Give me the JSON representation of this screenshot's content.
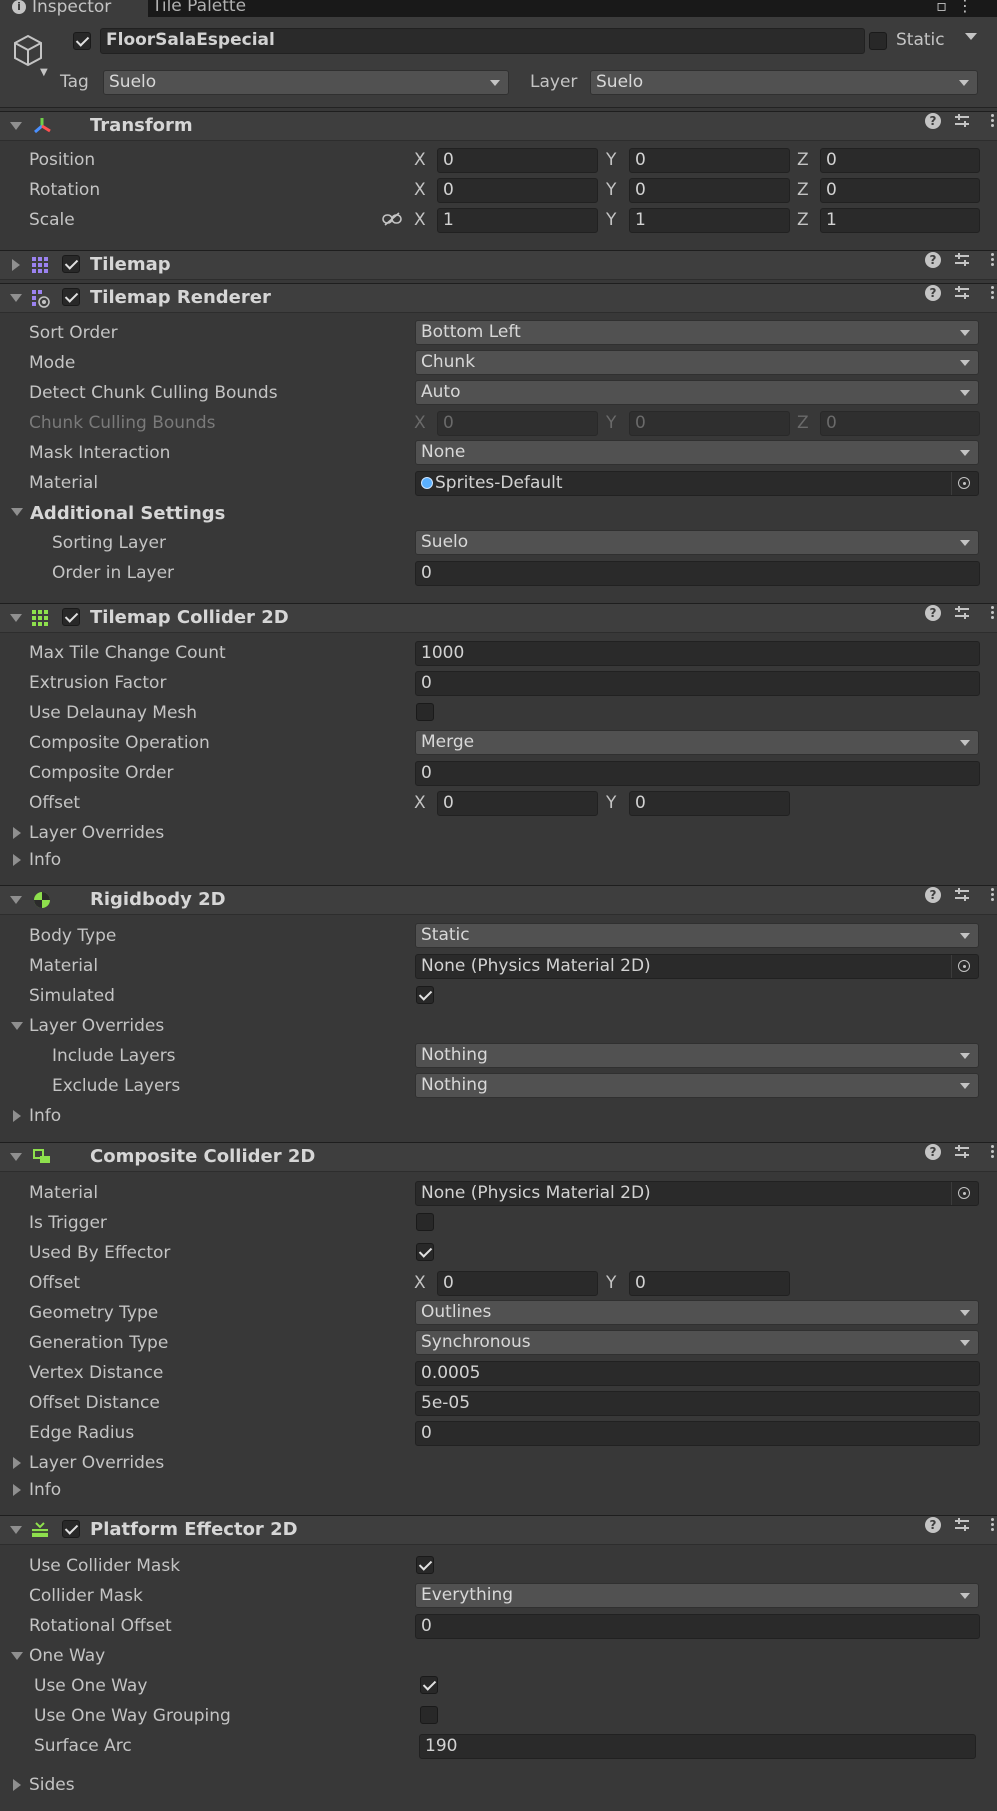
{
  "tabs": {
    "inspector": "Inspector",
    "tile_palette": "Tile Palette"
  },
  "gameobject": {
    "active": true,
    "name": "FloorSalaEspecial",
    "static_label": "Static",
    "static": false,
    "tag_label": "Tag",
    "tag": "Suelo",
    "layer_label": "Layer",
    "layer": "Suelo"
  },
  "transform": {
    "title": "Transform",
    "rows": [
      {
        "label": "Position",
        "x": "0",
        "y": "0",
        "z": "0"
      },
      {
        "label": "Rotation",
        "x": "0",
        "y": "0",
        "z": "0"
      },
      {
        "label": "Scale",
        "x": "1",
        "y": "1",
        "z": "1"
      }
    ]
  },
  "axes": {
    "x": "X",
    "y": "Y",
    "z": "Z"
  },
  "tilemap": {
    "title": "Tilemap",
    "enabled": true
  },
  "tilemap_renderer": {
    "title": "Tilemap Renderer",
    "enabled": true,
    "sort_order_label": "Sort Order",
    "sort_order": "Bottom Left",
    "mode_label": "Mode",
    "mode": "Chunk",
    "detect_label": "Detect Chunk Culling Bounds",
    "detect": "Auto",
    "chunk_label": "Chunk Culling Bounds",
    "chunk_x": "0",
    "chunk_y": "0",
    "chunk_z": "0",
    "mask_label": "Mask Interaction",
    "mask": "None",
    "material_label": "Material",
    "material": "Sprites-Default",
    "additional_label": "Additional Settings",
    "sorting_layer_label": "Sorting Layer",
    "sorting_layer": "Suelo",
    "order_label": "Order in Layer",
    "order": "0"
  },
  "tilemap_collider": {
    "title": "Tilemap Collider 2D",
    "enabled": true,
    "max_label": "Max Tile Change Count",
    "max": "1000",
    "extrusion_label": "Extrusion Factor",
    "extrusion": "0",
    "delaunay_label": "Use Delaunay Mesh",
    "delaunay": false,
    "composite_op_label": "Composite Operation",
    "composite_op": "Merge",
    "composite_order_label": "Composite Order",
    "composite_order": "0",
    "offset_label": "Offset",
    "offset_x": "0",
    "offset_y": "0",
    "layer_overrides_label": "Layer Overrides",
    "info_label": "Info"
  },
  "rigidbody": {
    "title": "Rigidbody 2D",
    "body_type_label": "Body Type",
    "body_type": "Static",
    "material_label": "Material",
    "material": "None (Physics Material 2D)",
    "simulated_label": "Simulated",
    "simulated": true,
    "layer_overrides_label": "Layer Overrides",
    "include_label": "Include Layers",
    "include": "Nothing",
    "exclude_label": "Exclude Layers",
    "exclude": "Nothing",
    "info_label": "Info"
  },
  "composite": {
    "title": "Composite Collider 2D",
    "material_label": "Material",
    "material": "None (Physics Material 2D)",
    "trigger_label": "Is Trigger",
    "trigger": false,
    "effector_label": "Used By Effector",
    "effector": true,
    "offset_label": "Offset",
    "offset_x": "0",
    "offset_y": "0",
    "geometry_label": "Geometry Type",
    "geometry": "Outlines",
    "generation_label": "Generation Type",
    "generation": "Synchronous",
    "vertex_label": "Vertex Distance",
    "vertex": "0.0005",
    "offset_dist_label": "Offset Distance",
    "offset_dist": "5e-05",
    "edge_label": "Edge Radius",
    "edge": "0",
    "layer_overrides_label": "Layer Overrides",
    "info_label": "Info"
  },
  "platform": {
    "title": "Platform Effector 2D",
    "enabled": true,
    "use_mask_label": "Use Collider Mask",
    "use_mask": true,
    "mask_label": "Collider Mask",
    "mask": "Everything",
    "rot_label": "Rotational Offset",
    "rot": "0",
    "one_way_label": "One Way",
    "use_one_way_label": "Use One Way",
    "use_one_way": true,
    "grouping_label": "Use One Way Grouping",
    "grouping": false,
    "arc_label": "Surface Arc",
    "arc": "190",
    "sides_label": "Sides"
  },
  "colors": {
    "background": "#383838",
    "field": "#2a2a2a",
    "dropdown": "#515151",
    "accent_green": "#8ee04d",
    "accent_blue": "#5ab0ff",
    "accent_purple": "#9b82f0"
  }
}
